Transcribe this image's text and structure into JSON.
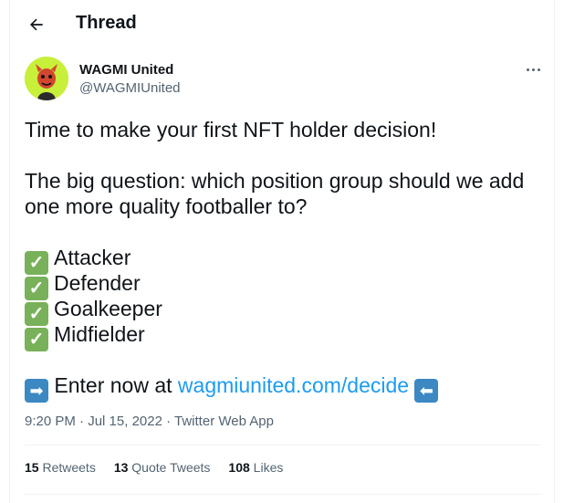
{
  "header": {
    "title": "Thread"
  },
  "author": {
    "display_name": "WAGMI United",
    "handle": "@WAGMIUnited"
  },
  "tweet": {
    "line1": "Time to make your first NFT holder decision!",
    "line2": "The big question: which position group should we add",
    "line3": "one more quality footballer to?",
    "positions": [
      "Attacker",
      "Defender",
      "Goalkeeper",
      "Midfielder"
    ],
    "check_glyph": "✓",
    "enter_prefix": "Enter now at ",
    "link": "wagmiunited.com/decide",
    "right_arrow_glyph": "➡",
    "left_arrow_glyph": "⬅"
  },
  "meta": {
    "time": "9:20 PM",
    "dot": " · ",
    "date": "Jul 15, 2022",
    "source": "Twitter Web App"
  },
  "stats": {
    "retweets_count": "15",
    "retweets_label": " Retweets",
    "quotes_count": "13",
    "quotes_label": " Quote Tweets",
    "likes_count": "108",
    "likes_label": " Likes"
  },
  "colors": {
    "accent": "#1d9bf0",
    "check": "#78b159",
    "arrow": "#3b88c3",
    "avatar_bg": "#c8ef3a"
  },
  "icons": {
    "back": "back-arrow-icon",
    "more": "more-icon"
  }
}
